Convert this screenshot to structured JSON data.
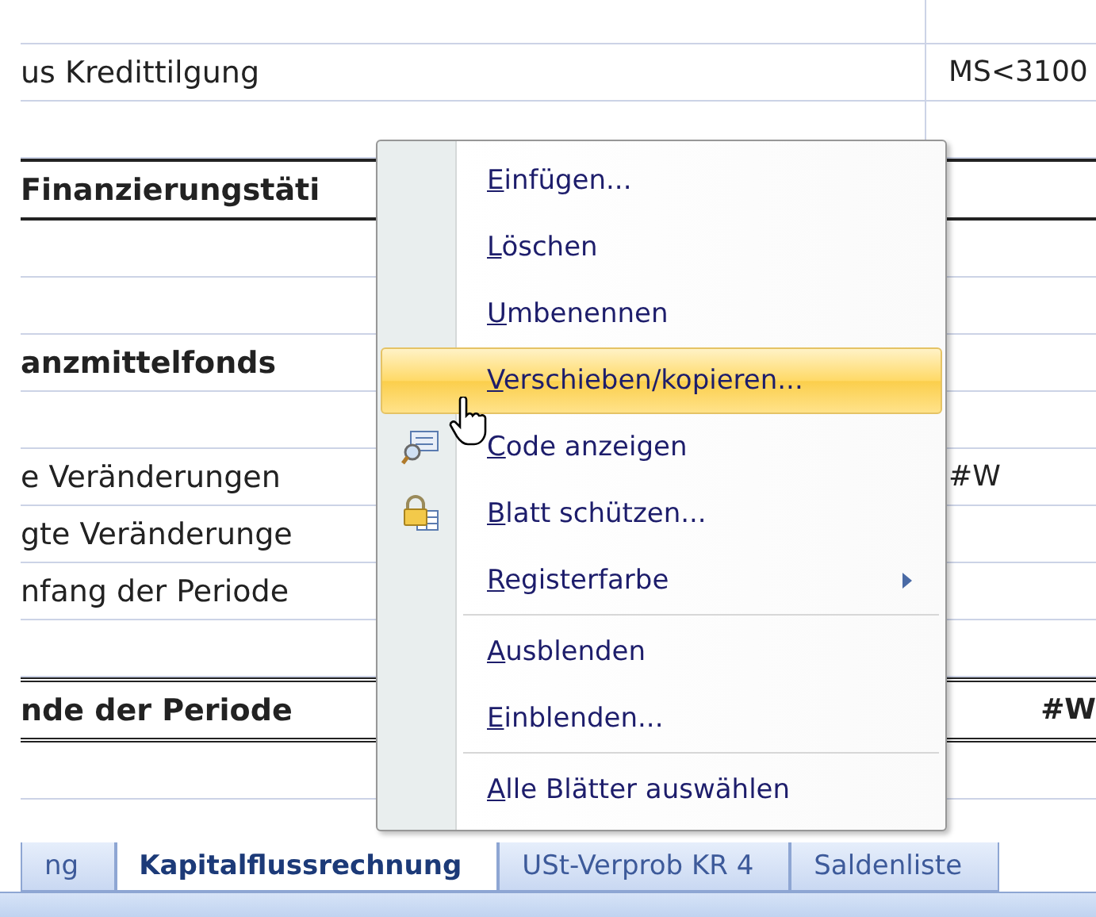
{
  "sheet": {
    "rows": [
      {
        "kind": "blank",
        "label": "",
        "value": ""
      },
      {
        "kind": "normal",
        "label": "us Kredittilgung",
        "value": "MS<3100"
      },
      {
        "kind": "blank",
        "label": "",
        "value": ""
      },
      {
        "kind": "bold",
        "label": "Finanzierungstäti",
        "value": ""
      },
      {
        "kind": "blank",
        "label": "",
        "value": ""
      },
      {
        "kind": "blank",
        "label": "",
        "value": ""
      },
      {
        "kind": "heading",
        "label": "anzmittelfonds",
        "value": ""
      },
      {
        "kind": "blank",
        "label": "",
        "value": ""
      },
      {
        "kind": "normal",
        "label": "e Veränderungen",
        "value": "#W"
      },
      {
        "kind": "normal",
        "label": "gte Veränderunge",
        "value": ""
      },
      {
        "kind": "normal",
        "label": "nfang der Periode",
        "value": ""
      },
      {
        "kind": "blank",
        "label": "",
        "value": ""
      },
      {
        "kind": "total",
        "label": "nde der Periode",
        "value": "#W"
      },
      {
        "kind": "blank",
        "label": "",
        "value": ""
      }
    ]
  },
  "context_menu": {
    "items": [
      {
        "kind": "item",
        "label": "Einfügen...",
        "selected": false
      },
      {
        "kind": "item",
        "label": "Löschen",
        "selected": false
      },
      {
        "kind": "item",
        "label": "Umbenennen",
        "selected": false
      },
      {
        "kind": "item",
        "label": "Verschieben/kopieren...",
        "selected": true
      },
      {
        "kind": "code",
        "label": "Code anzeigen",
        "selected": false
      },
      {
        "kind": "lock",
        "label": "Blatt schützen...",
        "selected": false
      },
      {
        "kind": "submenu",
        "label": "Registerfarbe",
        "selected": false
      },
      {
        "kind": "separator"
      },
      {
        "kind": "item",
        "label": "Ausblenden",
        "selected": false
      },
      {
        "kind": "item",
        "label": "Einblenden...",
        "selected": false
      },
      {
        "kind": "separator"
      },
      {
        "kind": "item",
        "label": "Alle Blätter auswählen",
        "selected": false
      }
    ]
  },
  "sheet_tabs": [
    {
      "label": "ng",
      "selected": false
    },
    {
      "label": "Kapitalflussrechnung",
      "selected": true
    },
    {
      "label": "USt-Verprob KR 4",
      "selected": false
    },
    {
      "label": "Saldenliste",
      "selected": false
    }
  ]
}
